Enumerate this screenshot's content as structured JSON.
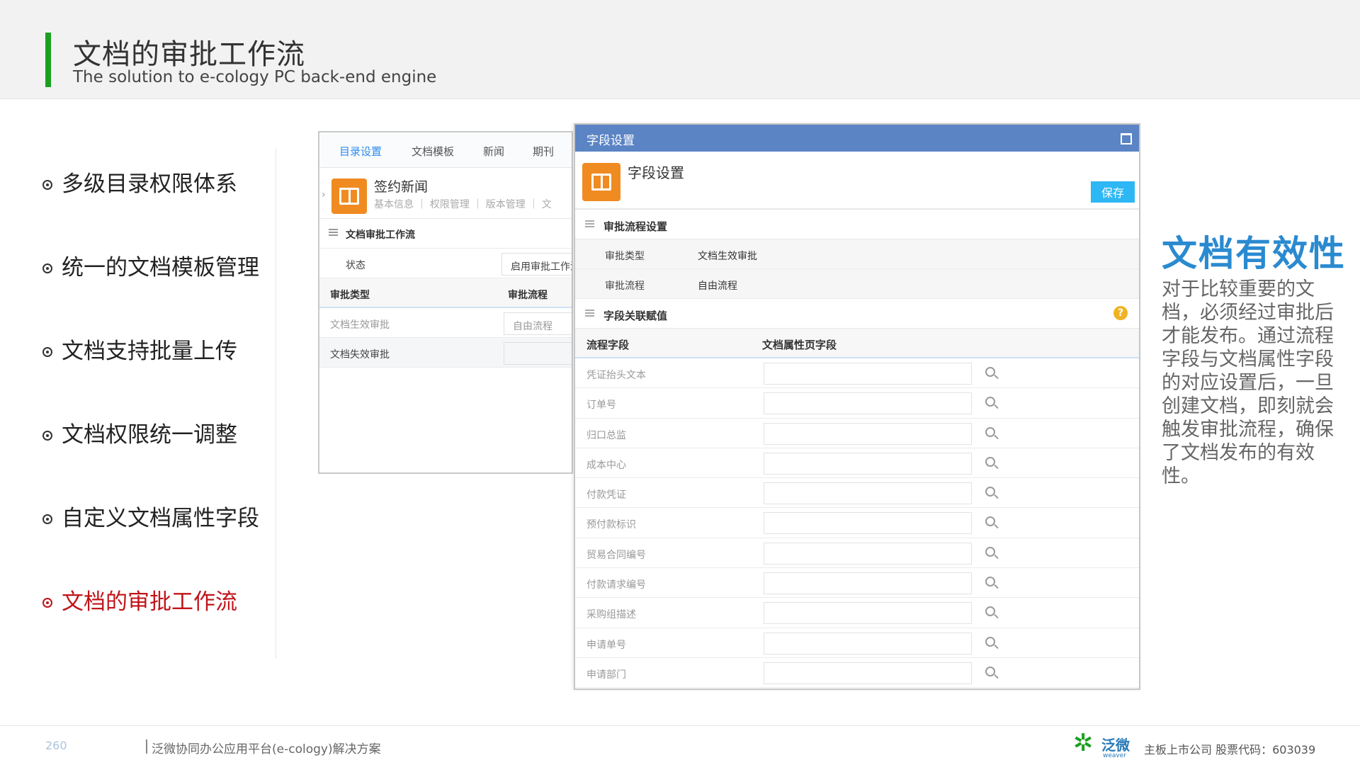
{
  "header": {
    "title": "文档的审批工作流",
    "subtitle": "The solution to e-cology PC back-end engine"
  },
  "features": [
    {
      "label": "多级目录权限体系",
      "active": false
    },
    {
      "label": "统一的文档模板管理",
      "active": false
    },
    {
      "label": "文档支持批量上传",
      "active": false
    },
    {
      "label": "文档权限统一调整",
      "active": false
    },
    {
      "label": "自定义文档属性字段",
      "active": false
    },
    {
      "label": "文档的审批工作流",
      "active": true
    }
  ],
  "back_panel": {
    "tabs": [
      "目录设置",
      "文档模板",
      "新闻",
      "期刊"
    ],
    "active_tab": "目录设置",
    "doc_title": "签约新闻",
    "doc_links": "基本信息 ｜ 权限管理 ｜ 版本管理 ｜ 文",
    "section_title": "文档审批工作流",
    "status_label": "状态",
    "status_value": "启用审批工作流",
    "col_type": "审批类型",
    "col_flow": "审批流程",
    "row1_type": "文档生效审批",
    "row1_flow": "自由流程",
    "row2_type": "文档失效审批",
    "row2_flow": ""
  },
  "dialog": {
    "window_title": "字段设置",
    "heading": "字段设置",
    "save_label": "保存",
    "section1": "审批流程设置",
    "approval_type_label": "审批类型",
    "approval_type_value": "文档生效审批",
    "approval_flow_label": "审批流程",
    "approval_flow_value": "自由流程",
    "section2": "字段关联赋值",
    "help_icon": "?",
    "col_flow_field": "流程字段",
    "col_doc_field": "文档属性页字段",
    "fields": [
      {
        "label": "凭证抬头文本",
        "value": ""
      },
      {
        "label": "订单号",
        "value": ""
      },
      {
        "label": "归口总监",
        "value": ""
      },
      {
        "label": "成本中心",
        "value": ""
      },
      {
        "label": "付款凭证",
        "value": ""
      },
      {
        "label": "预付款标识",
        "value": ""
      },
      {
        "label": "贸易合同编号",
        "value": ""
      },
      {
        "label": "付款请求编号",
        "value": ""
      },
      {
        "label": "采购组描述",
        "value": ""
      },
      {
        "label": "申请单号",
        "value": ""
      },
      {
        "label": "申请部门",
        "value": ""
      }
    ]
  },
  "right": {
    "title": "文档有效性",
    "body": "对于比较重要的文档，必须经过审批后才能发布。通过流程字段与文档属性字段的对应设置后，一旦创建文档，即刻就会触发审批流程，确保了文档发布的有效性。"
  },
  "footer": {
    "page_number": "260",
    "platform_text": "泛微协同办公应用平台(e-cology)解决方案",
    "logo_cn": "泛微",
    "logo_en": "weaver",
    "company_info": "主板上市公司    股票代码：603039"
  },
  "colors": {
    "accent_green": "#1aa01e",
    "active_red": "#c0141a",
    "dialog_title_blue": "#5b84c4",
    "save_blue": "#2db7f5",
    "icon_orange": "#f08b22",
    "headline_blue": "#2a8ad0"
  }
}
